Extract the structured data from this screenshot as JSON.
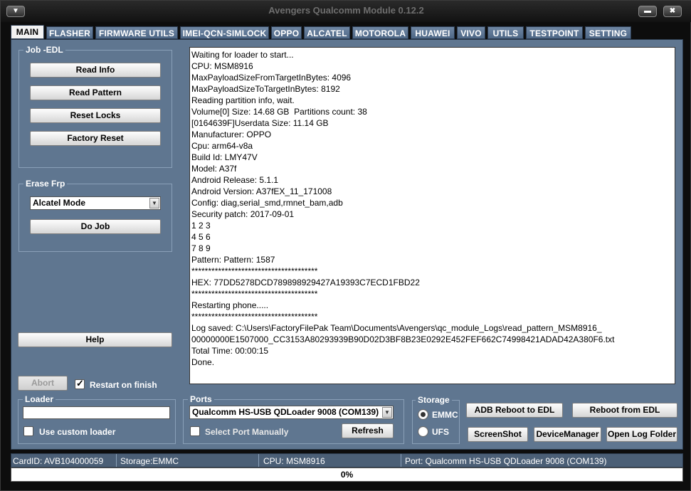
{
  "app": {
    "title": "Avengers Qualcomm Module 0.12.2",
    "menu_icon": "chevron-down-icon",
    "minimize_icon": "minimize-icon",
    "close_icon": "close-icon"
  },
  "tabs": [
    "MAIN",
    "FLASHER",
    "FIRMWARE UTILS",
    "IMEI-QCN-SIMLOCK",
    "OPPO",
    "ALCATEL",
    "MOTOROLA",
    "HUAWEI",
    "VIVO",
    "UTILS",
    "TESTPOINT",
    "SETTING"
  ],
  "active_tab": "MAIN",
  "job_edl": {
    "title": "Job -EDL",
    "buttons": [
      "Read Info",
      "Read Pattern",
      "Reset Locks",
      "Factory Reset"
    ]
  },
  "erase_frp": {
    "title": "Erase Frp",
    "mode_selected": "Alcatel Mode",
    "do_job": "Do Job"
  },
  "help_button": "Help",
  "abort_button": "Abort",
  "restart_on_finish": {
    "label": "Restart on finish",
    "checked": true
  },
  "log_lines": [
    "Waiting for loader to start...",
    "CPU: MSM8916",
    "MaxPayloadSizeFromTargetInBytes: 4096",
    "MaxPayloadSizeToTargetInBytes: 8192",
    "Reading partition info, wait.",
    "Volume[0] Size: 14.68 GB  Partitions count: 38",
    "[0164639F]Userdata Size: 11.14 GB",
    "Manufacturer: OPPO",
    "Cpu: arm64-v8a",
    "Build Id: LMY47V",
    "Model: A37f",
    "Android Release: 5.1.1",
    "Android Version: A37fEX_11_171008",
    "Config: diag,serial_smd,rmnet_bam,adb",
    "Security patch: 2017-09-01",
    "1 2 3",
    "4 5 6",
    "7 8 9",
    "Pattern: Pattern: 1587",
    "**************************************",
    "HEX: 77DD5278DCD789898929427A19393C7ECD1FBD22",
    "**************************************",
    "Restarting phone.....",
    "**************************************",
    "Log saved: C:\\Users\\FactoryFilePak Team\\Documents\\Avengers\\qc_module_Logs\\read_pattern_MSM8916_",
    "00000000E1507000_CC3153A80293939B90D02D3BF8B23E0292E452FEF662C74998421ADAD42A380F6.txt",
    "Total Time: 00:00:15",
    "Done."
  ],
  "loader": {
    "title": "Loader",
    "value": "",
    "use_custom_label": "Use custom loader",
    "use_custom_checked": false
  },
  "ports": {
    "title": "Ports",
    "selected": "Qualcomm HS-USB QDLoader 9008 (COM139)",
    "select_manually_label": "Select Port Manually",
    "select_manually_checked": false,
    "refresh": "Refresh"
  },
  "storage": {
    "title": "Storage",
    "options": [
      "EMMC",
      "UFS"
    ],
    "selected": "EMMC"
  },
  "actions": {
    "adb_reboot": "ADB Reboot to EDL",
    "reboot_from_edl": "Reboot from EDL",
    "screenshot": "ScreenShot",
    "device_manager": "DeviceManager",
    "open_log_folder": "Open Log Folder"
  },
  "status": {
    "card_id": "CardID: AVB104000059",
    "storage": "Storage:EMMC",
    "cpu": "CPU: MSM8916",
    "port": "Port: Qualcomm HS-USB QDLoader 9008 (COM139)"
  },
  "progress": {
    "percent": 0,
    "label": "0%"
  }
}
